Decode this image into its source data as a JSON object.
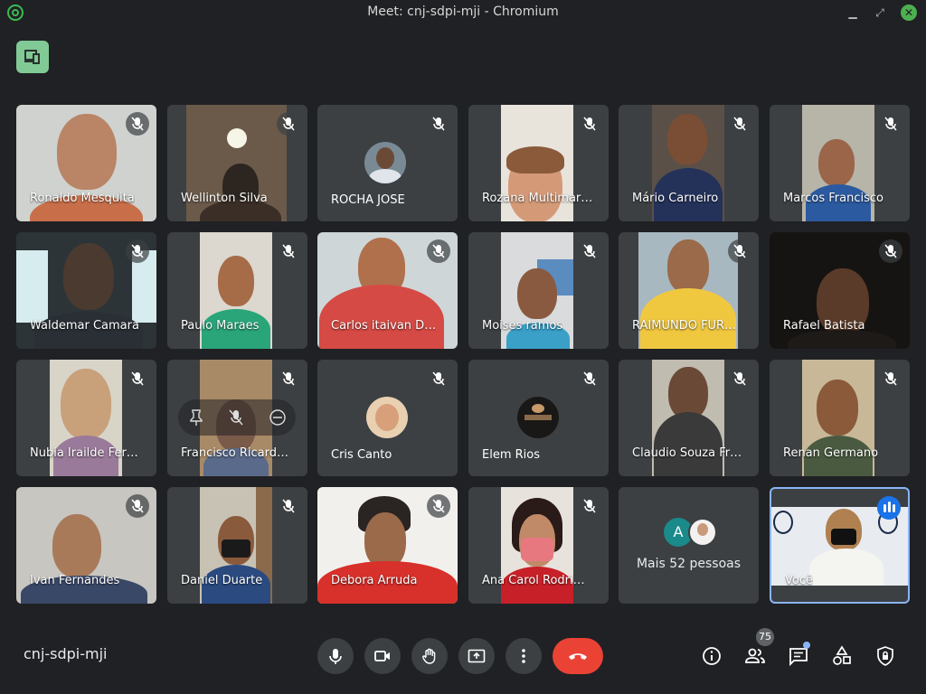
{
  "window": {
    "title": "Meet: cnj-sdpi-mji - Chromium"
  },
  "meeting": {
    "code": "cnj-sdpi-mji"
  },
  "participants": [
    {
      "name": "Ronaldo Mesquita"
    },
    {
      "name": "Wellinton Silva"
    },
    {
      "name": "ROCHA JOSE"
    },
    {
      "name": "Rozana Multimar…"
    },
    {
      "name": "Mário Carneiro"
    },
    {
      "name": "Marcos Francisco"
    },
    {
      "name": "Waldemar Camara"
    },
    {
      "name": "Paulo Maraes"
    },
    {
      "name": "Carlos itaivan D…"
    },
    {
      "name": "Moises ramos"
    },
    {
      "name": "RAIMUNDO FUR…"
    },
    {
      "name": "Rafael Batista"
    },
    {
      "name": "Nubia Irailde Fer…"
    },
    {
      "name": "Francisco Ricard…"
    },
    {
      "name": "Cris Canto"
    },
    {
      "name": "Elem Rios"
    },
    {
      "name": "Claudio Souza Fr…"
    },
    {
      "name": "Renan Germano"
    },
    {
      "name": "Ivan Fernandes"
    },
    {
      "name": "Daniel Duarte"
    },
    {
      "name": "Debora Arruda"
    },
    {
      "name": "Ana Carol Rodri…"
    }
  ],
  "more": {
    "label": "Mais 52 pessoas",
    "avatar_letter": "A"
  },
  "self": {
    "name": "Você"
  },
  "controls": {
    "people_count": "75"
  },
  "colors": {
    "background": "#202124",
    "tile": "#3c4043",
    "hangup": "#ea4335",
    "accent_green": "#81c995",
    "self_border": "#8ab4f8"
  },
  "icons": [
    "microphone-icon",
    "camera-icon",
    "raise-hand-icon",
    "present-icon",
    "more-options-icon",
    "hangup-icon",
    "info-icon",
    "people-icon",
    "chat-icon",
    "activities-icon",
    "host-controls-icon",
    "mic-off-icon",
    "device-icon"
  ]
}
